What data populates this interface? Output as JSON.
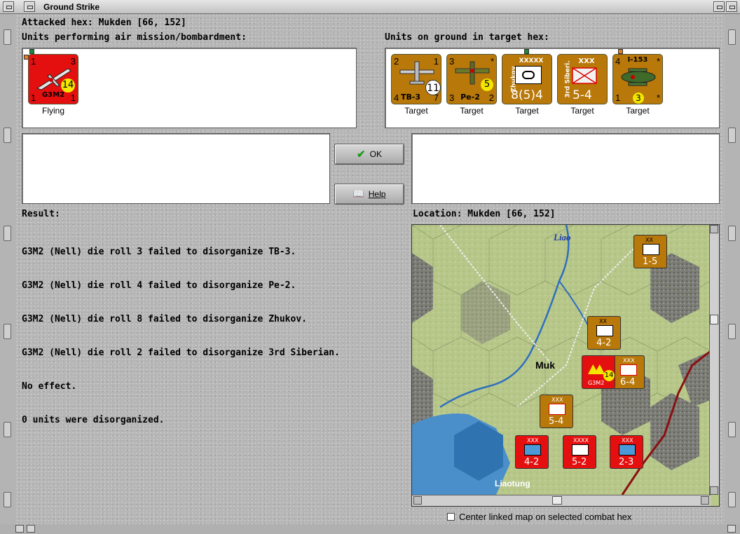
{
  "window": {
    "title": "Ground Strike"
  },
  "header": {
    "attacked_hex": "Attacked hex: Mukden  [66, 152]"
  },
  "air_units": {
    "label": "Units performing air mission/bombardment:",
    "items": [
      {
        "name": "G3M2",
        "status": "Flying",
        "top_left": "1",
        "top_right": "3",
        "bottom_left": "1",
        "bottom_right": "1",
        "badge": "14",
        "color": "#e41010"
      }
    ]
  },
  "ground_units": {
    "label": "Units on ground in target hex:",
    "items": [
      {
        "name": "TB-3",
        "status": "Target",
        "top_left": "2",
        "top_right": "1",
        "bottom_left": "4",
        "bottom_right": "7",
        "badge": "11",
        "type": "aircraft"
      },
      {
        "name": "Pe-2",
        "status": "Target",
        "top_left": "3",
        "top_right": "*",
        "bottom_left": "3",
        "bottom_right": "2",
        "badge": "5",
        "type": "aircraft"
      },
      {
        "name": "Zhukov",
        "status": "Target",
        "size": "XXXXX",
        "strength": "8(5)4",
        "type": "hq"
      },
      {
        "name": "3rd Siberi.",
        "status": "Target",
        "size": "XXX",
        "strength": "5-4",
        "type": "infantry"
      },
      {
        "name": "I-153",
        "status": "Target",
        "top_left": "4",
        "top_right": "*",
        "bottom_left": "1",
        "bottom_right": "*",
        "badge": "3",
        "type": "aircraft"
      }
    ]
  },
  "buttons": {
    "ok": "OK",
    "help": "Help"
  },
  "result": {
    "label": "Result:",
    "lines": [
      "G3M2 (Nell) die roll 3 failed to disorganize TB-3.",
      "G3M2 (Nell) die roll 4 failed to disorganize Pe-2.",
      "G3M2 (Nell) die roll 8 failed to disorganize Zhukov.",
      "G3M2 (Nell) die roll 2 failed to disorganize 3rd Siberian.",
      "No effect.",
      "0 units were disorganized."
    ]
  },
  "location": {
    "label": "Location:  Mukden  [66, 152]",
    "map_labels": {
      "river": "Liao",
      "city": "Muk",
      "peninsula": "Liaotung"
    },
    "counters": [
      {
        "strength": "1-5",
        "size": "XX"
      },
      {
        "strength": "4-2",
        "size": "XX"
      },
      {
        "strength": "6-4",
        "size": "XXX"
      },
      {
        "strength": "5-4",
        "size": "XXX"
      },
      {
        "strength": "4-2",
        "size": "XXX"
      },
      {
        "strength": "5-2",
        "size": "XXXX"
      },
      {
        "strength": "2-3",
        "size": "XXX"
      }
    ],
    "map_air_counter": {
      "name": "G3M2",
      "badge": "14"
    }
  },
  "footer": {
    "checkbox_label": "Center linked map on selected combat hex",
    "checked": false
  }
}
